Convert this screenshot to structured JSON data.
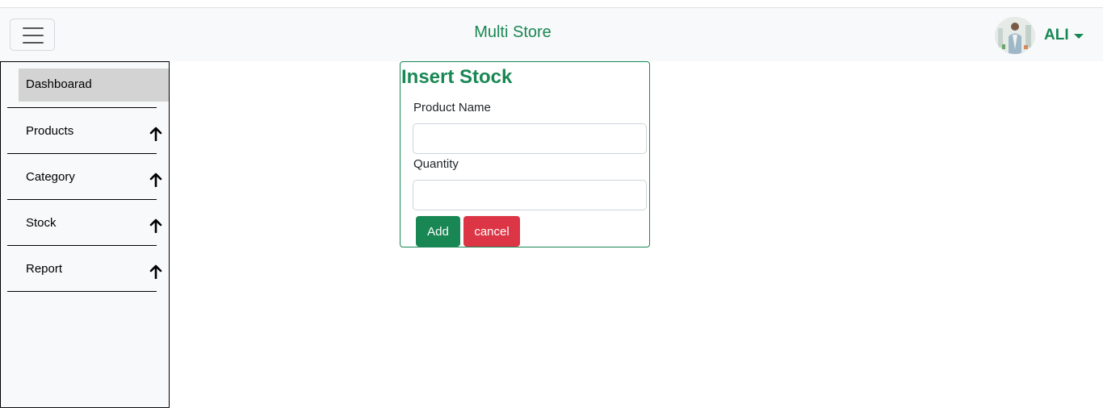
{
  "header": {
    "brand": "Multi Store",
    "user_name": "ALI"
  },
  "sidebar": {
    "items": [
      {
        "label": "Dashboarad"
      },
      {
        "label": "Products"
      },
      {
        "label": "Category"
      },
      {
        "label": "Stock"
      },
      {
        "label": "Report"
      }
    ]
  },
  "form": {
    "title": "Insert Stock",
    "product_label": "Product Name",
    "product_value": "",
    "quantity_label": "Quantity",
    "quantity_value": "",
    "add_label": "Add",
    "cancel_label": "cancel"
  },
  "colors": {
    "accent": "#198754",
    "danger": "#dc3545",
    "navbar_bg": "#f8f9fa",
    "active_item_bg": "#d3d3d3"
  }
}
